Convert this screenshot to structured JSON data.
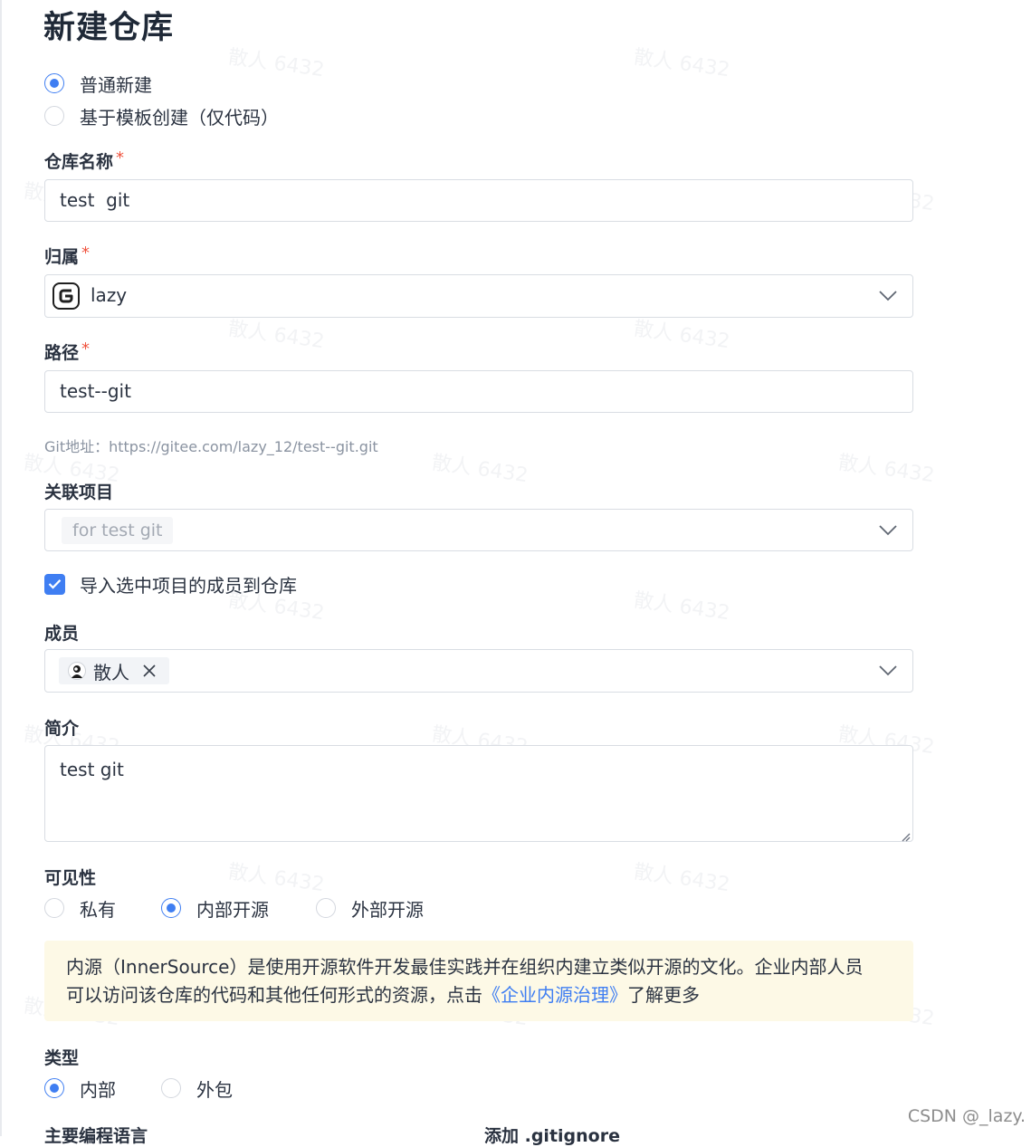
{
  "page": {
    "title": "新建仓库"
  },
  "creation_mode": {
    "options": [
      {
        "label": "普通新建",
        "selected": true
      },
      {
        "label": "基于模板创建（仅代码）",
        "selected": false
      }
    ]
  },
  "repo_name": {
    "label": "仓库名称",
    "required": "*",
    "value": "test  git"
  },
  "owner": {
    "label": "归属",
    "required": "*",
    "value": "lazy"
  },
  "path": {
    "label": "路径",
    "required": "*",
    "value": "test--git",
    "git_url": "Git地址：https://gitee.com/lazy_12/test--git.git"
  },
  "project": {
    "label": "关联项目",
    "tag": "for test git"
  },
  "import_members": {
    "label": "导入选中项目的成员到仓库",
    "checked": true
  },
  "members": {
    "label": "成员",
    "tag": "散人"
  },
  "description": {
    "label": "简介",
    "value": "test git"
  },
  "visibility": {
    "label": "可见性",
    "options": [
      {
        "label": "私有",
        "selected": false
      },
      {
        "label": "内部开源",
        "selected": true
      },
      {
        "label": "外部开源",
        "selected": false
      }
    ],
    "notice_line1": "内源（InnerSource）是使用开源软件开发最佳实践并在组织内建立类似开源的文化。企业内部人员",
    "notice_line2_prefix": "可以访问该仓库的代码和其他任何形式的资源，点击",
    "notice_link": "《企业内源治理》",
    "notice_line2_suffix": "了解更多"
  },
  "type": {
    "label": "类型",
    "options": [
      {
        "label": "内部",
        "selected": true
      },
      {
        "label": "外包",
        "selected": false
      }
    ]
  },
  "language": {
    "label": "主要编程语言"
  },
  "gitignore": {
    "label": "添加 .gitignore"
  },
  "watermark": {
    "text": "散人 6432"
  },
  "csdn_watermark": "CSDN @_lazy.",
  "colors": {
    "accent": "#3f7ef2",
    "required": "#f0543f",
    "notice_bg": "#fdf9e6"
  }
}
